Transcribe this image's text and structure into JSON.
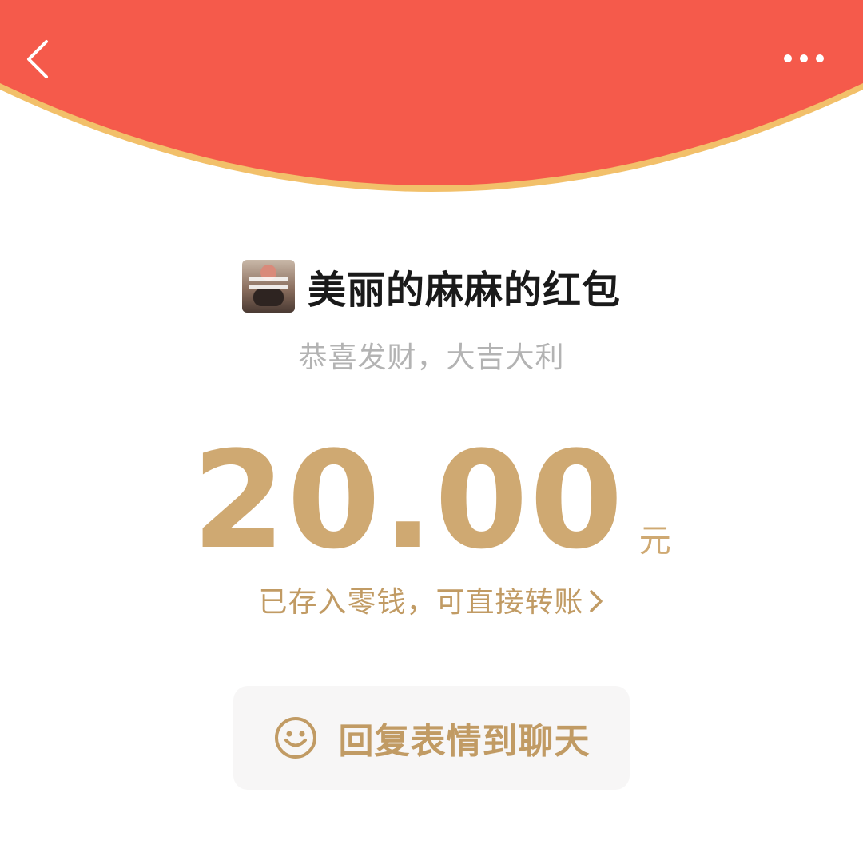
{
  "header": {
    "back_icon": "chevron-left-icon",
    "more_icon": "ellipsis-icon",
    "background_color": "#f55a4b",
    "rim_color": "#f2c06a"
  },
  "sender": {
    "avatar_icon": "avatar-photo",
    "name": "美丽的麻麻的红包"
  },
  "greeting": "恭喜发财，大吉大利",
  "amount": {
    "value": "20.00",
    "unit": "元",
    "color": "#cfa972"
  },
  "saved_note": {
    "text": "已存入零钱，可直接转账",
    "icon": "chevron-right-icon"
  },
  "reply_button": {
    "icon": "smile-icon",
    "label": "回复表情到聊天"
  }
}
